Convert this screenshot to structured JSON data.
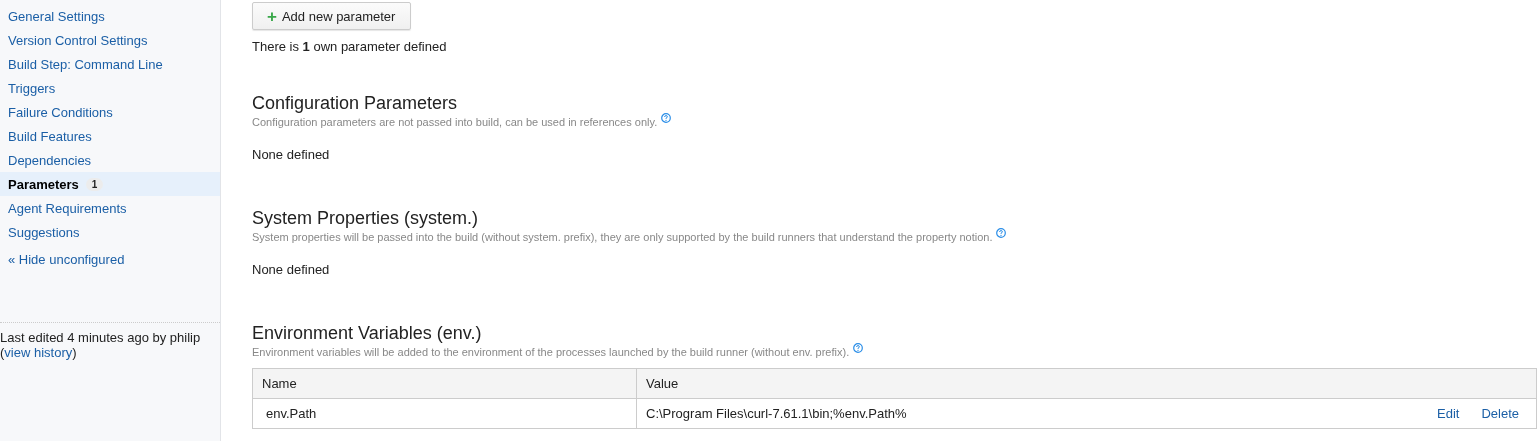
{
  "sidebar": {
    "items": [
      {
        "label": "General Settings",
        "selected": false
      },
      {
        "label": "Version Control Settings",
        "selected": false
      },
      {
        "label": "Build Step: Command Line",
        "selected": false
      },
      {
        "label": "Triggers",
        "selected": false
      },
      {
        "label": "Failure Conditions",
        "selected": false
      },
      {
        "label": "Build Features",
        "selected": false
      },
      {
        "label": "Dependencies",
        "selected": false
      },
      {
        "label": "Parameters",
        "selected": true,
        "badge": "1"
      },
      {
        "label": "Agent Requirements",
        "selected": false
      },
      {
        "label": "Suggestions",
        "selected": false
      }
    ],
    "toggle_link": "« Hide unconfigured",
    "last_edited": "Last edited 4 minutes ago by philip",
    "history_open": "(",
    "history_link": "view history",
    "history_close": ")"
  },
  "add_button": {
    "icon": "+",
    "label": "Add new parameter"
  },
  "summary": "There is **1** own parameter defined",
  "sections": [
    {
      "title": "Configuration Parameters",
      "description": "Configuration parameters are not passed into build, can be used in references only.",
      "empty_text": "None defined"
    },
    {
      "title": "System Properties (system.)",
      "description": "System properties will be passed into the build (without system. prefix), they are only supported by the build runners that understand the property notion.",
      "empty_text": "None defined"
    },
    {
      "title": "Environment Variables (env.)",
      "description": "Environment variables will be added to the environment of the processes launched by the build runner (without env. prefix).",
      "table": {
        "columns": [
          "Name",
          "Value"
        ],
        "rows": [
          {
            "name": "env.Path",
            "value": "C:\\Program Files\\curl-7.61.1\\bin;%env.Path%",
            "actions": [
              "Edit",
              "Delete"
            ]
          }
        ]
      }
    }
  ]
}
